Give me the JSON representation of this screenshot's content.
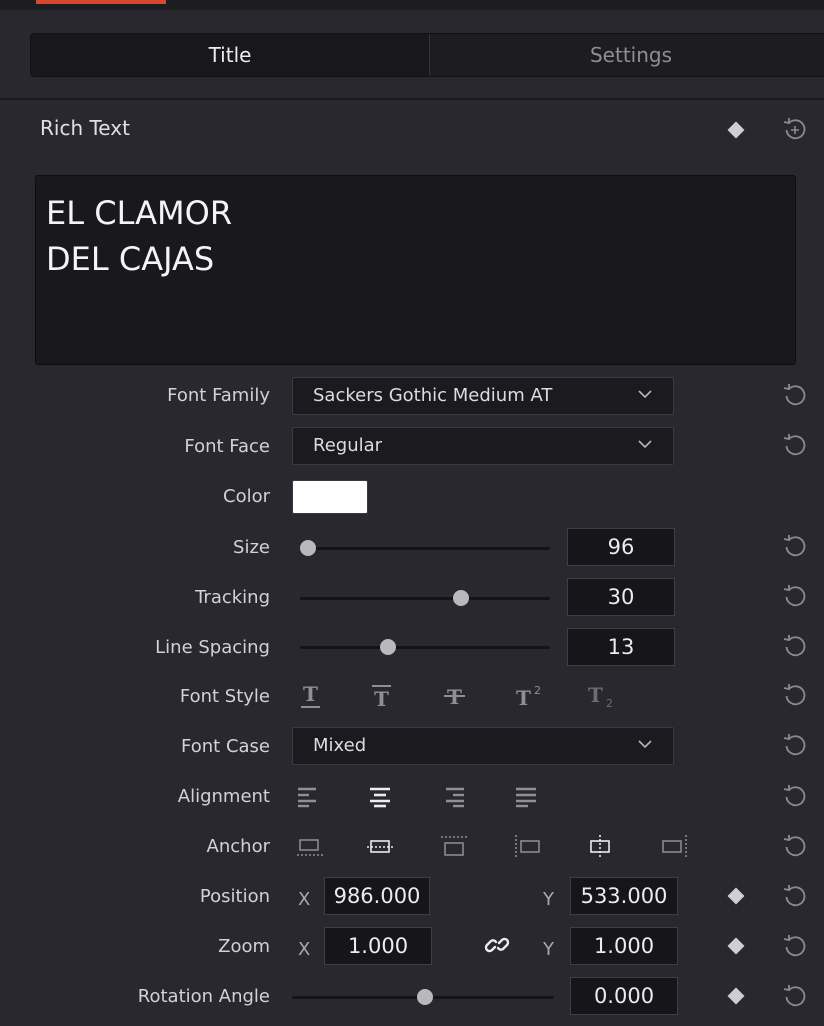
{
  "tabs": {
    "title": "Title",
    "settings": "Settings"
  },
  "rich_text": {
    "heading": "Rich Text",
    "content": "EL CLAMOR\nDEL CAJAS"
  },
  "properties": {
    "font_family": {
      "label": "Font Family",
      "value": "Sackers Gothic Medium AT"
    },
    "font_face": {
      "label": "Font Face",
      "value": "Regular"
    },
    "color": {
      "label": "Color",
      "value": "#ffffff"
    },
    "size": {
      "label": "Size",
      "value": "96"
    },
    "tracking": {
      "label": "Tracking",
      "value": "30"
    },
    "line_spacing": {
      "label": "Line Spacing",
      "value": "13"
    },
    "font_style": {
      "label": "Font Style",
      "options": [
        "underline",
        "overline",
        "strikethrough",
        "superscript",
        "subscript"
      ]
    },
    "font_case": {
      "label": "Font Case",
      "value": "Mixed"
    },
    "alignment": {
      "label": "Alignment",
      "options": [
        "left",
        "center",
        "right",
        "justify"
      ],
      "selected": "center"
    },
    "anchor": {
      "label": "Anchor"
    },
    "position": {
      "label": "Position",
      "x_label": "X",
      "x": "986.000",
      "y_label": "Y",
      "y": "533.000"
    },
    "zoom": {
      "label": "Zoom",
      "x_label": "X",
      "x": "1.000",
      "y_label": "Y",
      "y": "1.000"
    },
    "rotation": {
      "label": "Rotation Angle",
      "value": "0.000"
    }
  },
  "colors": {
    "accent": "#d5482f",
    "panel_bg": "#28282e",
    "field_bg": "#1b1b1f"
  },
  "icons": [
    "keyframe-diamond-icon",
    "reset-icon",
    "chevron-down-icon",
    "link-icon",
    "alignment-icons",
    "anchor-icons",
    "font-style-icons"
  ]
}
